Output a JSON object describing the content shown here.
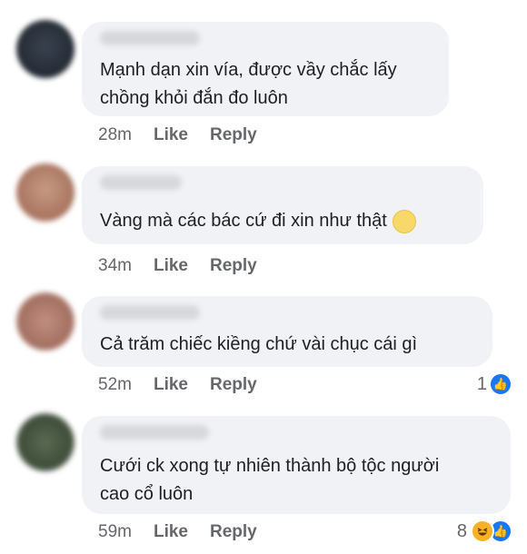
{
  "comments": [
    {
      "text_lines": [
        "Mạnh dạn xin vía, được vầy chắc lấy",
        "chồng khỏi đắn đo luôn"
      ],
      "time": "28m",
      "like_label": "Like",
      "reply_label": "Reply",
      "reaction_count": ""
    },
    {
      "text_lines": [
        "Vàng mà các bác cứ đi xin như thật"
      ],
      "time": "34m",
      "like_label": "Like",
      "reply_label": "Reply",
      "reaction_count": ""
    },
    {
      "text_lines": [
        "Cả trăm chiếc kiềng chứ vài chục cái gì"
      ],
      "time": "52m",
      "like_label": "Like",
      "reply_label": "Reply",
      "reaction_count": "1"
    },
    {
      "text_lines": [
        "Cưới ck xong tự nhiên thành bộ tộc người",
        "cao cổ luôn"
      ],
      "time": "59m",
      "like_label": "Like",
      "reply_label": "Reply",
      "reaction_count": "8"
    }
  ],
  "colors": {
    "bubble": "#f0f2f5",
    "meta_text": "#65676b",
    "like_blue": "#1877f2",
    "haha_yellow": "#f7b125"
  },
  "icons": [
    "like-reaction-icon",
    "haha-reaction-icon",
    "smiling-face-emoji-icon"
  ]
}
